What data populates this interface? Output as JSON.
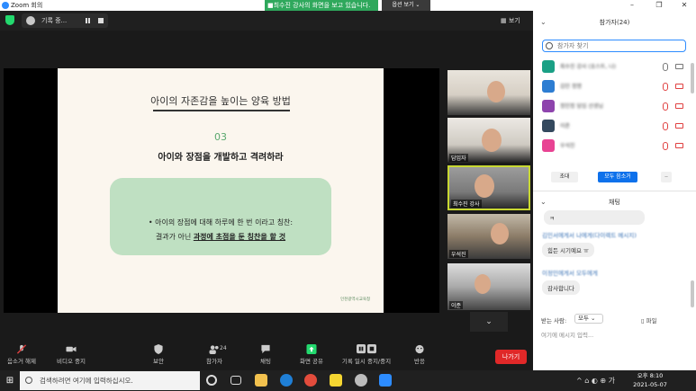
{
  "titlebar": {
    "app_title": "Zoom 회의",
    "share_banner": "■최수진 강사의 화면을 보고 있습니다.",
    "view_options": "옵션 보기 ⌄",
    "min": "–",
    "max": "❐",
    "close": "✕"
  },
  "topbar": {
    "recording_label": "기록 중...",
    "view_label": "▦ 보기"
  },
  "slide": {
    "heading": "아이의 자존감을 높이는 양육 방법",
    "number": "03",
    "subtitle": "아이와 장점을 개발하고 격려하라",
    "line1": "• 아이의 장점에 대해 하루에 한 번 이라고 칭찬:",
    "line2_prefix": "결과가 아닌 ",
    "line2_bold": "과정에 초점을 둔 칭찬을 할 것",
    "logo_text": "인천광역시교육청"
  },
  "thumbnails": [
    {
      "name": ""
    },
    {
      "name": "담임자"
    },
    {
      "name": "최수진 강사"
    },
    {
      "name": "우석진"
    },
    {
      "name": "이준"
    }
  ],
  "scroll_down_label": "⌄",
  "toolbar": {
    "mute": "음소거 해제",
    "video": "비디오 중지",
    "security": "보안",
    "participants": "참가자",
    "participants_count": "24",
    "chat": "채팅",
    "share": "화면 공유",
    "record": "기록 일시 중지/중지",
    "reactions": "반응",
    "leave": "나가기"
  },
  "panel": {
    "participants_title": "참가자(24)",
    "search_placeholder": "참가자 찾기",
    "participants": [
      {
        "name": "최수진 강사 (호스트, 나)",
        "color": "#1aa085",
        "mic_off": false,
        "cam_off": false
      },
      {
        "name": "김민 정명",
        "color": "#2d7dd2",
        "mic_off": true,
        "cam_off": true
      },
      {
        "name": "정민정 담임 선생님",
        "color": "#8e44ad",
        "mic_off": true,
        "cam_off": true
      },
      {
        "name": "이준",
        "color": "#34495e",
        "mic_off": true,
        "cam_off": true
      },
      {
        "name": "우석진",
        "color": "#e84393",
        "mic_off": true,
        "cam_off": true
      }
    ],
    "invite": "초대",
    "mute_all": "모두 음소거",
    "more": "..",
    "chat_title": "채팅",
    "chat_messages": [
      {
        "meta": "",
        "text": "ㅋ"
      },
      {
        "meta": "김민서에게서 나에게(다이렉트 메시지)",
        "text": "힘든 시기예요 ㅠ"
      },
      {
        "meta": "이정민에게서 모두에게",
        "text": "감사합니다"
      }
    ],
    "recv_label": "받는 사람:",
    "recv_value": "모두 ⌄",
    "file": "파일",
    "input_placeholder": "여기에 메시지 입력..."
  },
  "taskbar": {
    "start": "⊞",
    "search_placeholder": "검색하려면 여기에 입력하십시오.",
    "tray": "^ ⌂ ◐ ⊕ 가",
    "time": "오후 8:10",
    "date": "2021-05-07"
  },
  "colors": {
    "zoom_blue": "#2d8cff",
    "leave_red": "#e02828",
    "share_green": "#23d96e",
    "banner_green": "#2fa85c"
  }
}
